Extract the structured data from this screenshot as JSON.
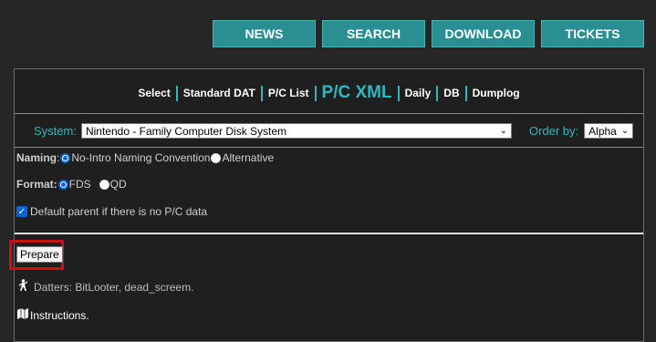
{
  "nav": {
    "news": "NEWS",
    "search": "SEARCH",
    "download": "DOWNLOAD",
    "tickets": "TICKETS"
  },
  "tabs": [
    "Select",
    "Standard DAT",
    "P/C List",
    "P/C XML",
    "Daily",
    "DB",
    "Dumplog"
  ],
  "active_tab": "P/C XML",
  "system": {
    "label": "System:",
    "value": "Nintendo - Family Computer Disk System"
  },
  "order": {
    "label": "Order by:",
    "value": "Alpha"
  },
  "naming": {
    "label": "Naming",
    "colon": ":",
    "options": [
      {
        "label": "No-Intro Naming Convention",
        "selected": true
      },
      {
        "label": "Alternative",
        "selected": false
      }
    ]
  },
  "format": {
    "label": "Format:",
    "options": [
      {
        "label": "FDS",
        "selected": true
      },
      {
        "label": "QD",
        "selected": false
      }
    ]
  },
  "default_parent": {
    "label": "Default parent if there is no P/C data",
    "checked": true
  },
  "prepare_label": "Prepare",
  "datters": "Datters: BitLooter, dead_screem.",
  "instructions": {
    "label": "Instructions",
    "suffix": "."
  },
  "colors": {
    "accent": "#2a8f92",
    "link_cyan": "#2fb8c2",
    "highlight": "#d01010",
    "checkbox_blue": "#0a64d6"
  },
  "icons": {
    "datters": "person-icon",
    "instructions": "map-icon",
    "dropdown": "chevron-down-icon"
  }
}
